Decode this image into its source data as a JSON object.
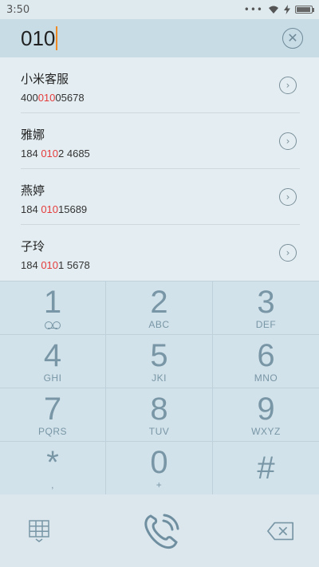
{
  "status": {
    "time": "3:50",
    "dots": "•••"
  },
  "dial": {
    "number": "010"
  },
  "contacts": [
    {
      "name": "小米客服",
      "phone_pre": "400",
      "phone_hl": "010",
      "phone_post": "05678"
    },
    {
      "name": "雅娜",
      "phone_pre": "184 ",
      "phone_hl": "010",
      "phone_post": "2 4685"
    },
    {
      "name": "燕婷",
      "phone_pre": "184 ",
      "phone_hl": "010",
      "phone_post": "15689"
    },
    {
      "name": "子玲",
      "phone_pre": "184 ",
      "phone_hl": "010",
      "phone_post": "1 5678"
    }
  ],
  "keys": [
    {
      "digit": "1",
      "letters": ""
    },
    {
      "digit": "2",
      "letters": "ABC"
    },
    {
      "digit": "3",
      "letters": "DEF"
    },
    {
      "digit": "4",
      "letters": "GHI"
    },
    {
      "digit": "5",
      "letters": "JKI"
    },
    {
      "digit": "6",
      "letters": "MNO"
    },
    {
      "digit": "7",
      "letters": "PQRS"
    },
    {
      "digit": "8",
      "letters": "TUV"
    },
    {
      "digit": "9",
      "letters": "WXYZ"
    },
    {
      "digit": "*",
      "letters": ","
    },
    {
      "digit": "0",
      "letters": "+"
    },
    {
      "digit": "#",
      "letters": ""
    }
  ],
  "colors": {
    "accent": "#f08a24",
    "highlight": "#e53b3b",
    "keypad_text": "#7896a6"
  }
}
